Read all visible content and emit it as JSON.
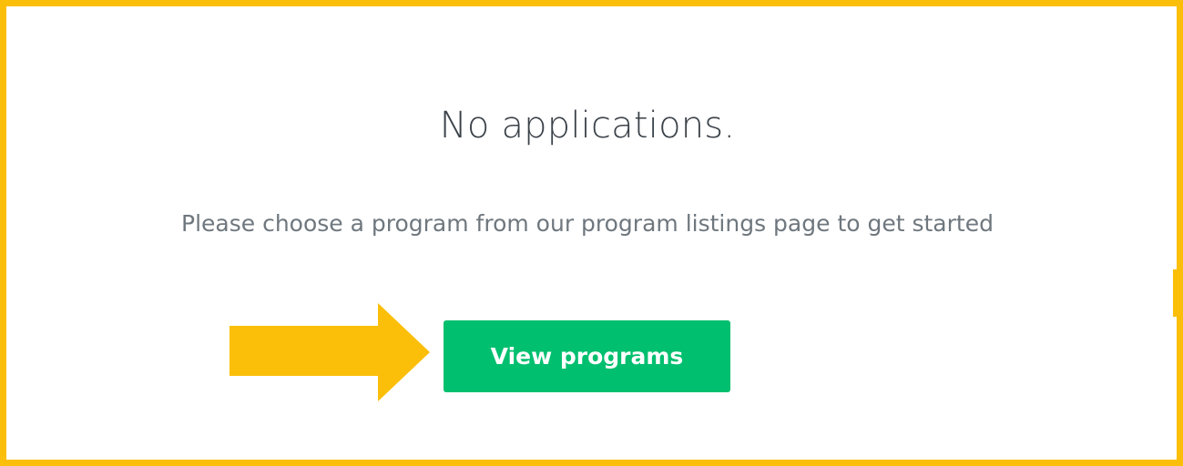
{
  "empty_state": {
    "title": "No applications.",
    "subtitle": "Please choose a program from our program listings page to get started",
    "button_label": "View programs"
  },
  "annotation": {
    "icon": "arrow-right-icon",
    "color": "#fbbf0a"
  },
  "colors": {
    "button": "#00bf6f",
    "frame": "#fbbf0a",
    "title": "#3a4148",
    "subtitle": "#6f777e"
  }
}
